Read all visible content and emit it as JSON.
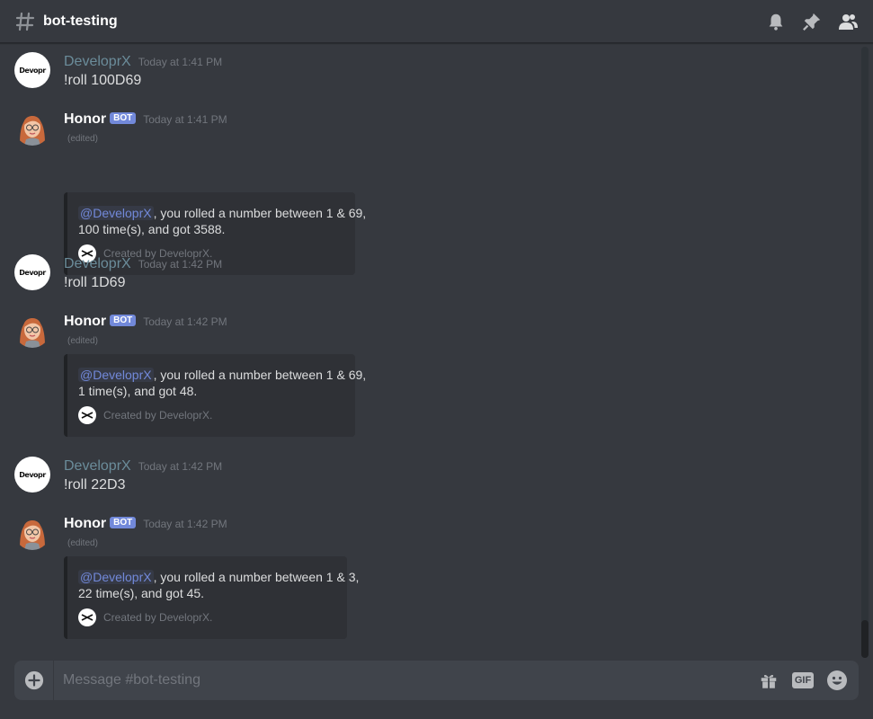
{
  "channel": {
    "name": "bot-testing",
    "input_placeholder": "Message #bot-testing"
  },
  "header_icons": [
    "bell-icon",
    "pin-icon",
    "members-icon"
  ],
  "composer_icons": [
    "plus-circle-icon",
    "gift-icon",
    "gif-button",
    "emoji-icon"
  ],
  "gif_label": "GIF",
  "colors": {
    "background": "#36393f",
    "bot_tag": "#7289da",
    "mention": "#7289da",
    "embed_bg": "#2f3136"
  },
  "messages": [
    {
      "author": "DeveloprX",
      "timestamp": "Today at 1:41 PM",
      "content": "!roll 100D69",
      "avatar_text": "Devopr"
    },
    {
      "author": "Honor",
      "bot_tag": "BOT",
      "timestamp": "Today at 1:41 PM",
      "edited": "(edited)",
      "embed": {
        "mention": "@DeveloprX",
        "line1": ", you rolled a number between 1 & 69,",
        "line2": "100 time(s), and got 3588.",
        "footer": "Created by DeveloprX."
      }
    },
    {
      "author": "DeveloprX",
      "timestamp": "Today at 1:42 PM",
      "content": "!roll 1D69",
      "avatar_text": "Devopr"
    },
    {
      "author": "Honor",
      "bot_tag": "BOT",
      "timestamp": "Today at 1:42 PM",
      "edited": "(edited)",
      "embed": {
        "mention": "@DeveloprX",
        "line1": ", you rolled a number between 1 & 69,",
        "line2": "1 time(s), and got 48.",
        "footer": "Created by DeveloprX."
      }
    },
    {
      "author": "DeveloprX",
      "timestamp": "Today at 1:42 PM",
      "content": "!roll 22D3",
      "avatar_text": "Devopr"
    },
    {
      "author": "Honor",
      "bot_tag": "BOT",
      "timestamp": "Today at 1:42 PM",
      "edited": "(edited)",
      "embed": {
        "mention": "@DeveloprX",
        "line1": ", you rolled a number between 1 & 3,",
        "line2": "22 time(s), and got 45.",
        "footer": "Created by DeveloprX."
      }
    }
  ]
}
